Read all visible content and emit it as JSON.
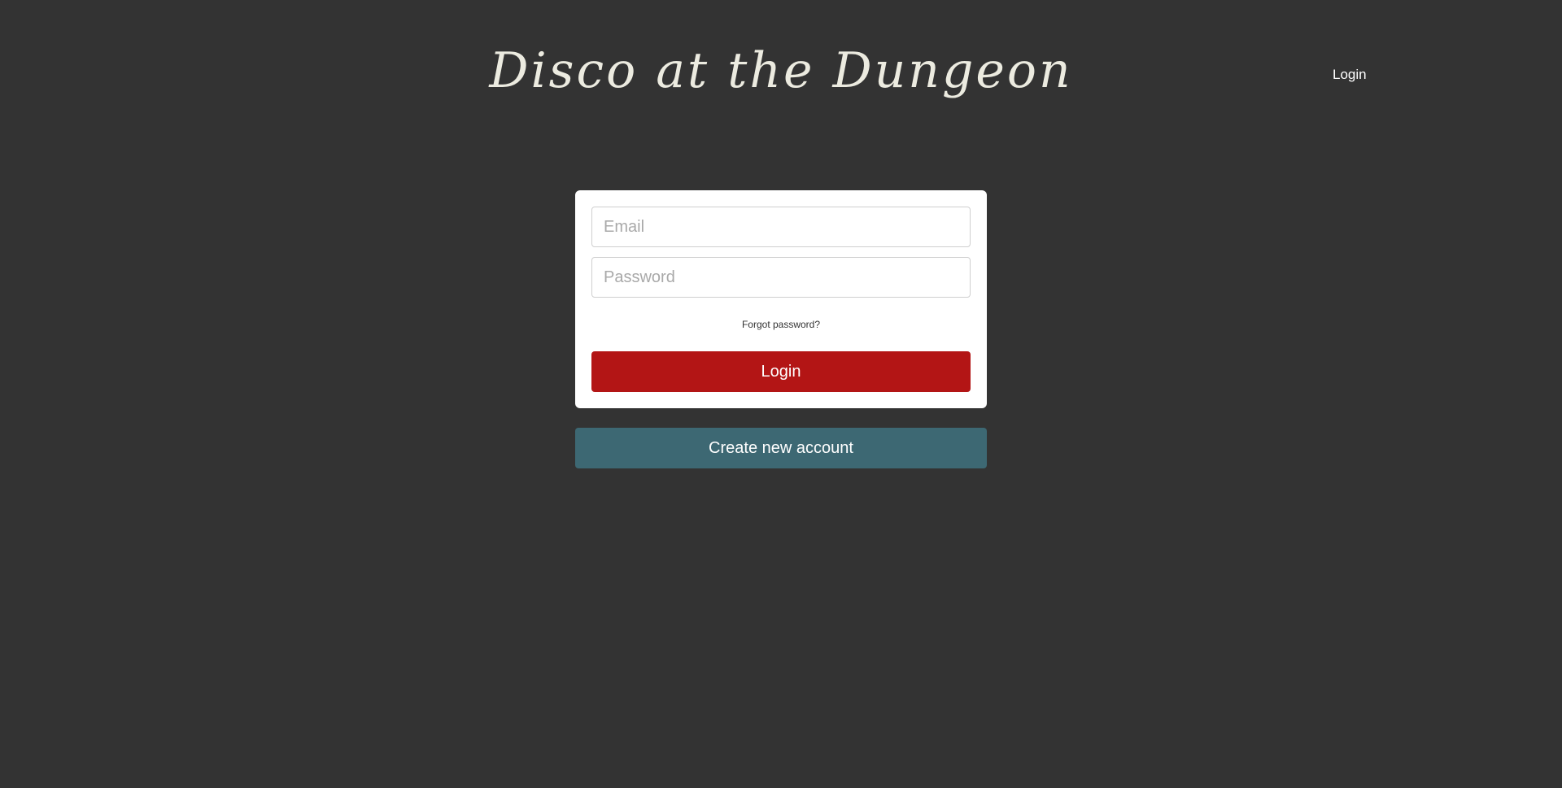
{
  "header": {
    "title": "Disco at the Dungeon",
    "nav_login": "Login"
  },
  "login_form": {
    "email_placeholder": "Email",
    "email_value": "",
    "password_placeholder": "Password",
    "password_value": "",
    "forgot_password": "Forgot password?",
    "submit_label": "Login"
  },
  "create_account": {
    "label": "Create new account"
  },
  "colors": {
    "background": "#333333",
    "title": "#ecebe0",
    "login_button": "#b31515",
    "create_button": "#3d6873",
    "card": "#ffffff"
  }
}
